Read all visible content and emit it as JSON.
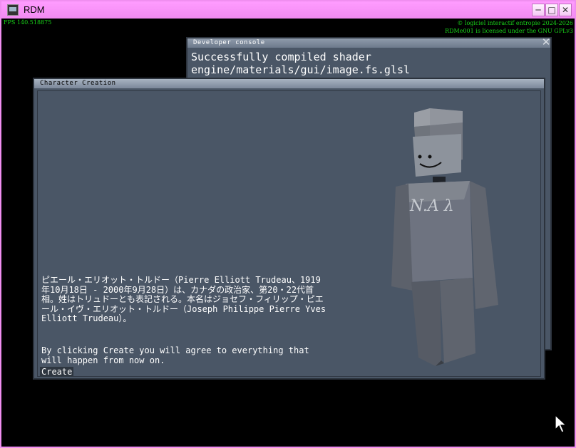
{
  "window": {
    "title": "RDM",
    "minimize_glyph": "─",
    "maximize_glyph": "□",
    "close_glyph": "✕"
  },
  "hud": {
    "fps": "FPS 140.518875",
    "copyright_line1": "© logiciel interactif entropie 2024-2026",
    "copyright_line2": "RDMe001 is licensed under the GNU GPLv3"
  },
  "console": {
    "title": "Developer console",
    "close_glyph": "✕",
    "lines": "Successfully compiled shader\nengine/materials/gui/image.fs.glsl"
  },
  "character_creation": {
    "title": "Character Creation",
    "bio_text": "ピエール・エリオット・トルドー（Pierre Elliott Trudeau、1919年10月18日 - 2000年9月28日）は、カナダの政治家、第20・22代首相。姓はトリュドーとも表記される。本名はジョセフ・フィリップ・ピエール・イヴ・エリオット・トルドー（Joseph Philippe Pierre Yves Elliott Trudeau）。",
    "agreement_text": "By clicking Create you will agree to everything that will happen from now on.",
    "create_label": "Create",
    "figure_shirt_text": "N.A λ"
  },
  "colors": {
    "titlebar": "#f28af2",
    "window_bg": "#4a5666",
    "hud_text": "#19d419"
  },
  "icons": {
    "app": "app-icon",
    "cursor": "mouse-cursor-icon"
  }
}
